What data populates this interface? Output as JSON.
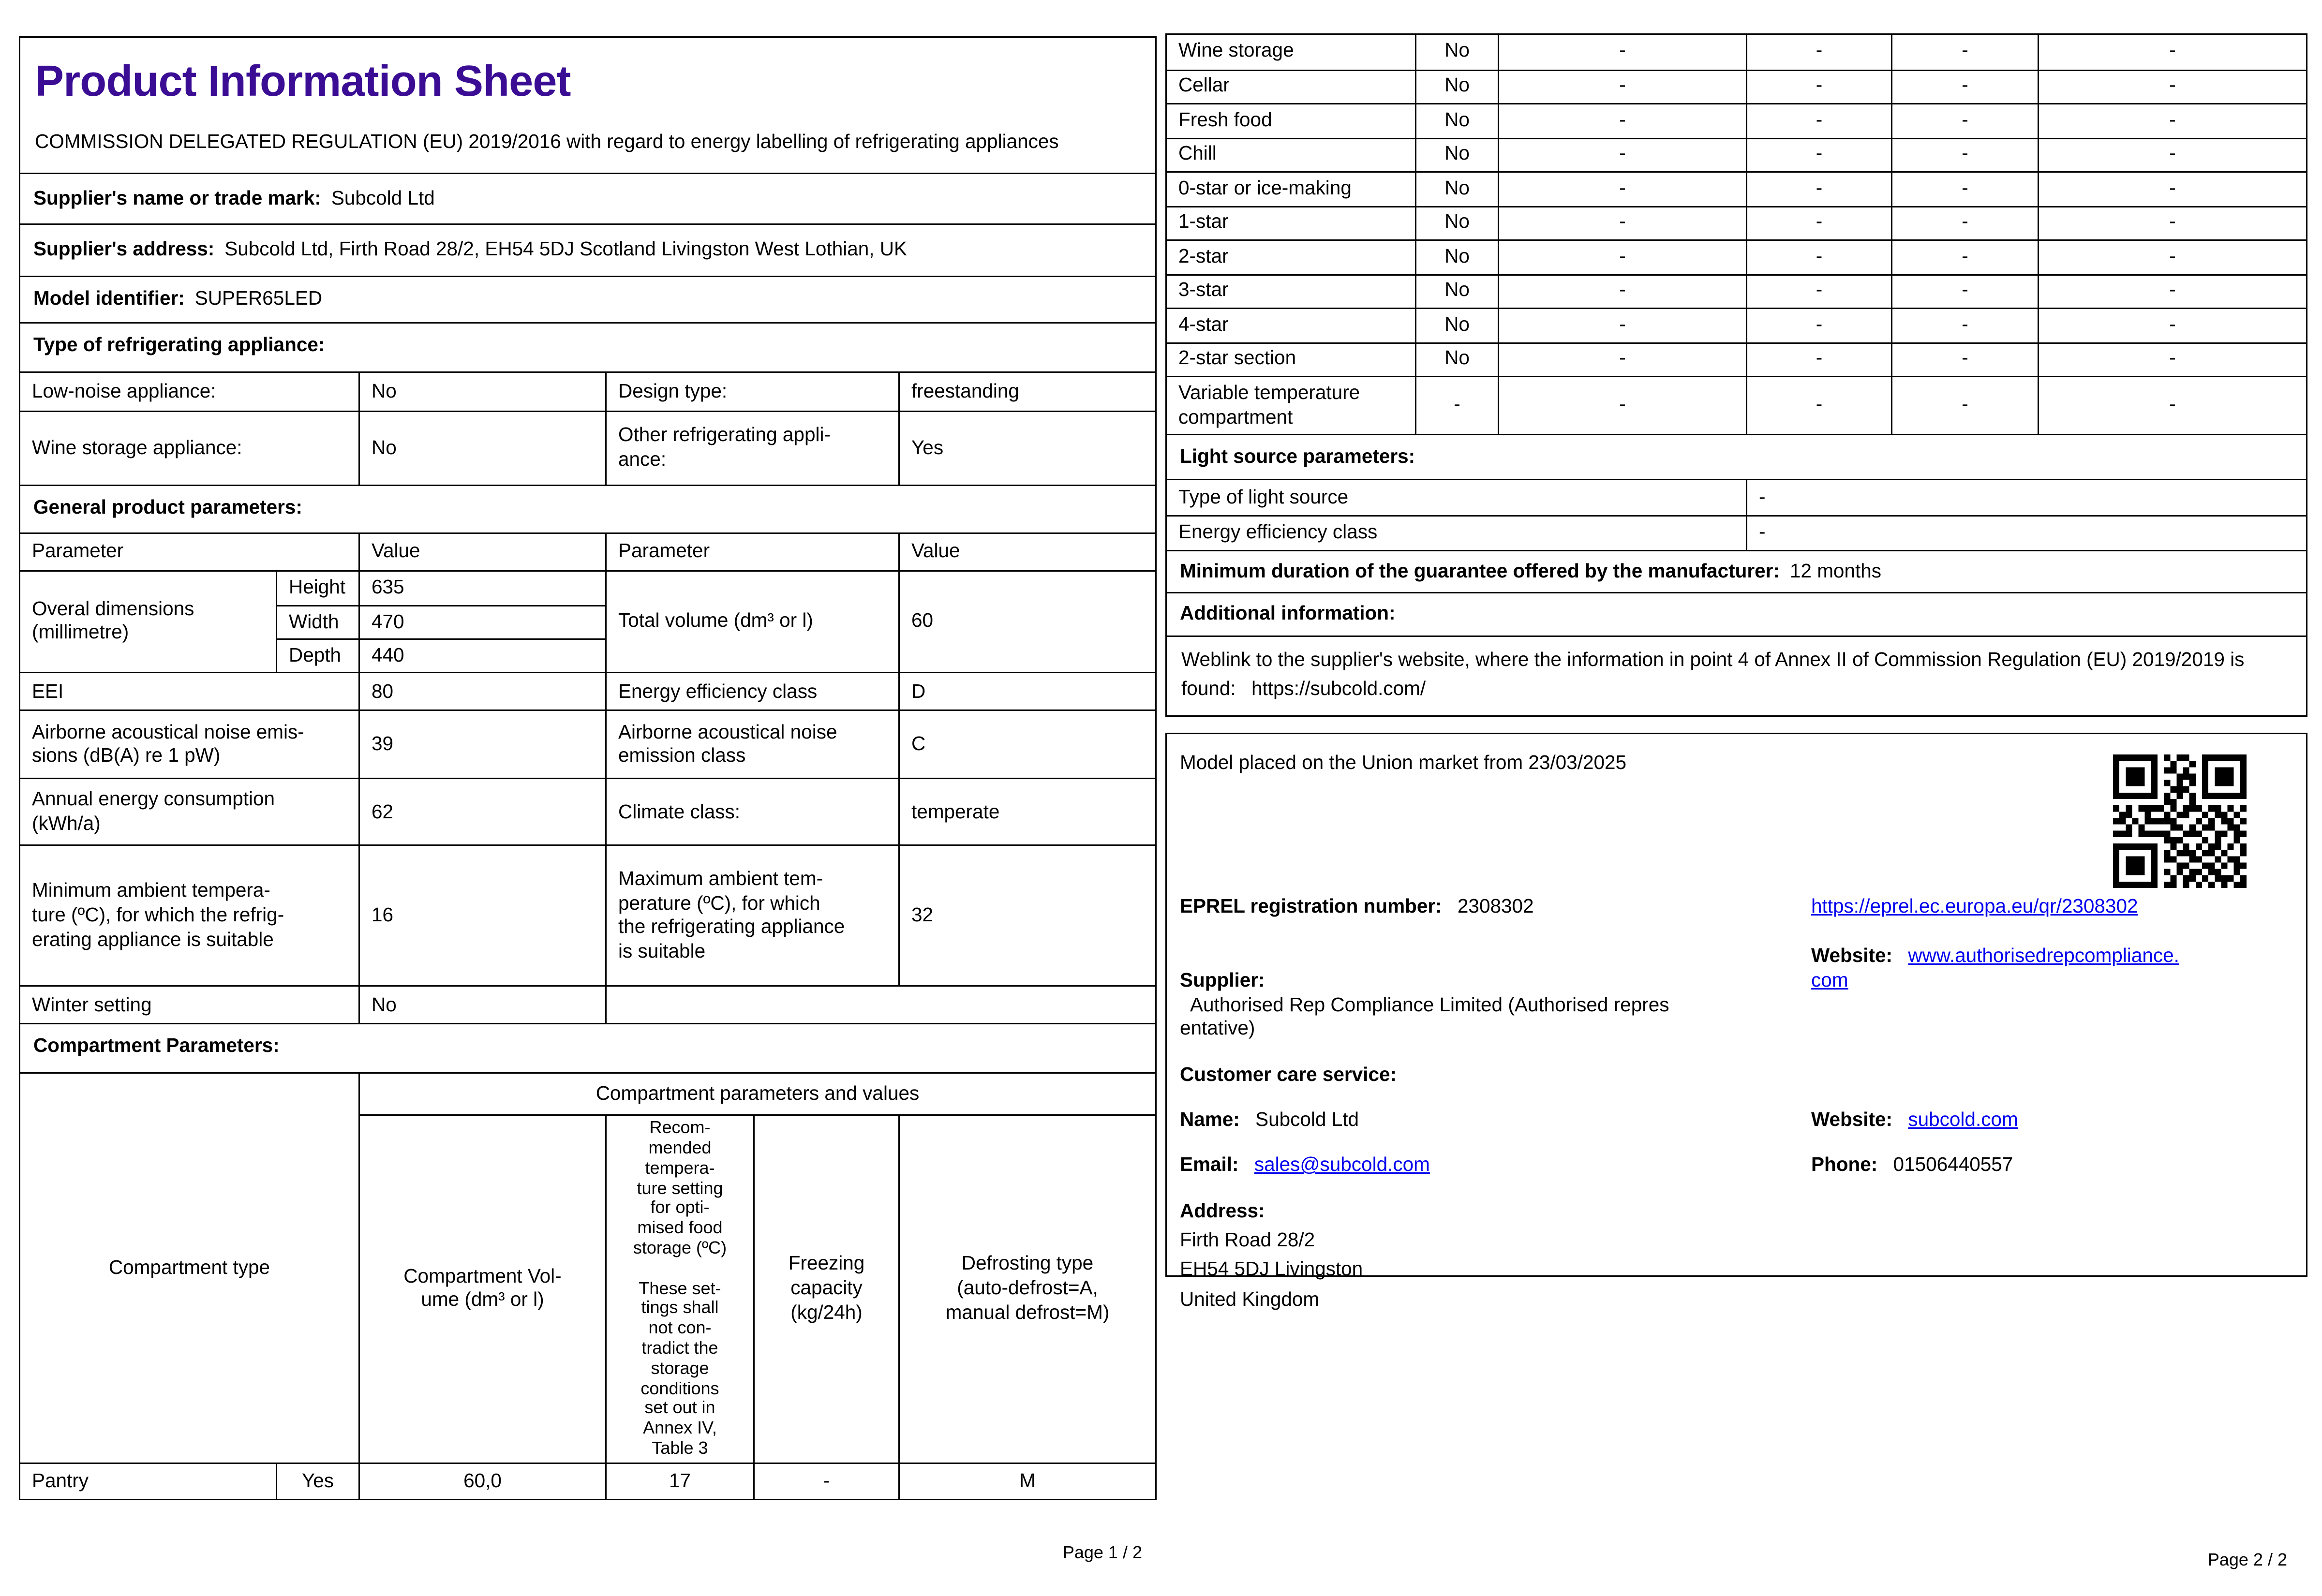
{
  "colors": {
    "title": "#3a0d94",
    "link": "#0000ee"
  },
  "icons": {
    "qr": "qr-code"
  },
  "page1": {
    "title": "Product Information Sheet",
    "regulation": "COMMISSION DELEGATED REGULATION (EU) 2019/2016 with regard to energy labelling of refrigerating appliances",
    "supplier_name_label": "Supplier's name or trade mark:",
    "supplier_name": "Subcold Ltd",
    "supplier_address_label": "Supplier's address:",
    "supplier_address": "Subcold Ltd, Firth Road 28/2, EH54 5DJ Scotland Livingston West Lothian, UK",
    "model_label": "Model identifier:",
    "model_value": "SUPER65LED",
    "type_section": "Type of refrigerating appliance:",
    "type_rows": [
      {
        "p1": "Low-noise appliance:",
        "v1": "No",
        "p2": "Design type:",
        "v2": "freestanding"
      },
      {
        "p1": "Wine storage appliance:",
        "v1": "No",
        "p2": "Other refrigerating appli-\nance:",
        "v2": "Yes"
      }
    ],
    "general_section": "General product parameters:",
    "param_header": [
      "Parameter",
      "Value",
      "Parameter",
      "Value"
    ],
    "dims": {
      "label": "Overal dimensions\n(millimetre)",
      "rows": [
        {
          "k": "Height",
          "v": "635"
        },
        {
          "k": "Width",
          "v": "470"
        },
        {
          "k": "Depth",
          "v": "440"
        }
      ],
      "p2": "Total volume (dm³ or l)",
      "v2": "60"
    },
    "gen_rows": [
      {
        "p1": "EEI",
        "v1": "80",
        "p2": "Energy efficiency class",
        "v2": "D"
      },
      {
        "p1": "Airborne acoustical noise emis-\nsions (dB(A) re 1 pW)",
        "v1": "39",
        "p2": "Airborne acoustical noise\nemission class",
        "v2": "C"
      },
      {
        "p1": "Annual energy consumption\n(kWh/a)",
        "v1": "62",
        "p2": "Climate class:",
        "v2": "temperate"
      },
      {
        "p1": "Minimum ambient tempera-\nture (ºC), for which the refrig-\nerating appliance is suitable",
        "v1": "16",
        "p2": "Maximum ambient tem-\nperature (ºC), for which\nthe refrigerating appliance\nis suitable",
        "v2": "32"
      },
      {
        "p1": "Winter setting",
        "v1": "No",
        "p2": "",
        "v2": ""
      }
    ],
    "compartment_section": "Compartment Parameters:",
    "comp": {
      "span_header": "Compartment parameters and values",
      "col1_header": "Compartment type",
      "headers": [
        "Compartment Vol-\nume (dm³ or l)",
        "Recom-\nmended\ntempera-\nture setting\nfor opti-\nmised food\nstorage (ºC)\n\nThese set-\ntings shall\nnot con-\ntradict the\nstorage\nconditions\nset out in\nAnnex IV,\nTable 3",
        "Freezing\ncapacity\n(kg/24h)",
        "Defrosting type\n(auto-defrost=A,\nmanual defrost=M)"
      ],
      "data_row": [
        "Pantry",
        "Yes",
        "60,0",
        "17",
        "-",
        "M"
      ]
    },
    "footer": "Page 1 / 2"
  },
  "page2": {
    "comp_rows": [
      {
        "label": "Wine storage",
        "present": "No",
        "values": [
          "-",
          "-",
          "-",
          "-"
        ]
      },
      {
        "label": "Cellar",
        "present": "No",
        "values": [
          "-",
          "-",
          "-",
          "-"
        ]
      },
      {
        "label": "Fresh food",
        "present": "No",
        "values": [
          "-",
          "-",
          "-",
          "-"
        ]
      },
      {
        "label": "Chill",
        "present": "No",
        "values": [
          "-",
          "-",
          "-",
          "-"
        ]
      },
      {
        "label": "0-star or ice-making",
        "present": "No",
        "values": [
          "-",
          "-",
          "-",
          "-"
        ]
      },
      {
        "label": "1-star",
        "present": "No",
        "values": [
          "-",
          "-",
          "-",
          "-"
        ]
      },
      {
        "label": "2-star",
        "present": "No",
        "values": [
          "-",
          "-",
          "-",
          "-"
        ]
      },
      {
        "label": "3-star",
        "present": "No",
        "values": [
          "-",
          "-",
          "-",
          "-"
        ]
      },
      {
        "label": "4-star",
        "present": "No",
        "values": [
          "-",
          "-",
          "-",
          "-"
        ]
      },
      {
        "label": "2-star section",
        "present": "No",
        "values": [
          "-",
          "-",
          "-",
          "-"
        ]
      },
      {
        "label": "Variable temperature\ncompartment",
        "present": "-",
        "values": [
          "-",
          "-",
          "-",
          "-"
        ]
      }
    ],
    "light_section": "Light source parameters:",
    "light_rows": [
      {
        "label": "Type of light source",
        "value": "-"
      },
      {
        "label": "Energy efficiency class",
        "value": "-"
      }
    ],
    "guarantee_label": "Minimum duration of the guarantee offered by the manufacturer:",
    "guarantee_value": "12 months",
    "additional_section": "Additional information:",
    "weblink_text": "Weblink to the supplier's website, where the information in point 4 of Annex II of Commission Regulation (EU) 2019/2019 is found:",
    "weblink_url": "https://subcold.com/",
    "market": {
      "placed_text": "Model placed on the Union market from 23/03/2025",
      "eprel_label": "EPREL registration number:",
      "eprel_value": "2308302",
      "eprel_link": "https://eprel.ec.europa.eu/qr/2308302",
      "supplier_label": "Supplier:",
      "supplier_value": "Authorised Rep Compliance Limited (Authorised repres\nentative)",
      "website_label": "Website:",
      "website_link": "www.authorisedrepcompliance.\ncom",
      "care_section": "Customer care service:",
      "name_label": "Name:",
      "name_value": "Subcold Ltd",
      "website2_label": "Website:",
      "website2_link": "subcold.com",
      "email_label": "Email:",
      "email_link": "sales@subcold.com",
      "phone_label": "Phone:",
      "phone_value": "01506440557",
      "address_label": "Address:",
      "address_lines": "Firth Road 28/2\n EH54 5DJ Livingston\nUnited Kingdom"
    },
    "footer": "Page 2 / 2"
  }
}
